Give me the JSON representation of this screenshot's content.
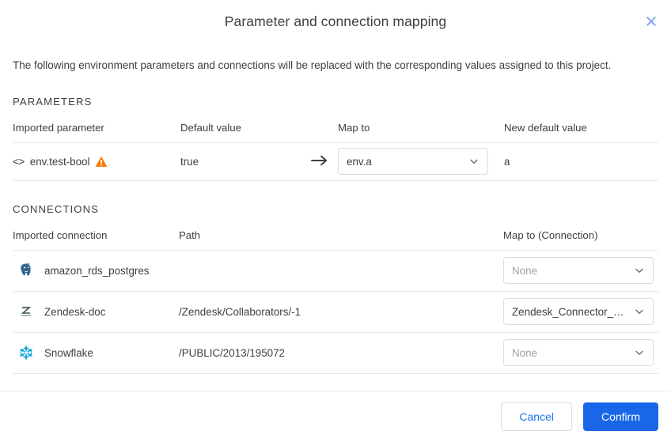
{
  "dialog": {
    "title": "Parameter and connection mapping",
    "close_label": "close-icon",
    "intro": "The following environment parameters and connections will be replaced with the corresponding values assigned to this project."
  },
  "parameters_section": {
    "heading": "PARAMETERS",
    "columns": {
      "imported": "Imported parameter",
      "default_value": "Default value",
      "map_to": "Map to",
      "new_default_value": "New default value"
    },
    "rows": [
      {
        "icon": "code-brackets-icon",
        "name": "env.test-bool",
        "warning": true,
        "default_value": "true",
        "arrow": "arrow-right-icon",
        "map_to": "env.a",
        "new_default_value": "a"
      }
    ]
  },
  "connections_section": {
    "heading": "CONNECTIONS",
    "columns": {
      "imported": "Imported connection",
      "path": "Path",
      "map_to": "Map to (Connection)"
    },
    "rows": [
      {
        "icon": "postgresql-icon",
        "name": "amazon_rds_postgres",
        "path": "",
        "map_to": "None",
        "map_to_is_placeholder": true
      },
      {
        "icon": "zendesk-icon",
        "name": "Zendesk-doc",
        "path": "/Zendesk/Collaborators/-1",
        "map_to": "Zendesk_Connector_…",
        "map_to_is_placeholder": false
      },
      {
        "icon": "snowflake-icon",
        "name": "Snowflake",
        "path": "/PUBLIC/2013/195072",
        "map_to": "None",
        "map_to_is_placeholder": true
      }
    ]
  },
  "footer": {
    "cancel_label": "Cancel",
    "confirm_label": "Confirm"
  },
  "colors": {
    "primary": "#1967e8",
    "link": "#1a73e8",
    "warning": "#f57c00",
    "text": "#3c4043",
    "placeholder": "#9aa0a6",
    "border": "#dadce0",
    "divider": "#e4e8ed",
    "snowflake": "#29b5e8",
    "postgres": "#336791"
  }
}
